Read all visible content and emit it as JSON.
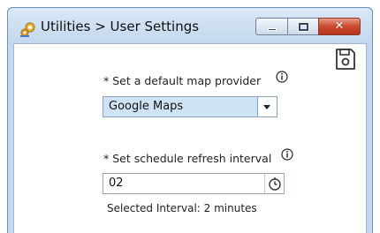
{
  "window": {
    "title": "Utilities > User Settings",
    "minimize_label": "minimize",
    "maximize_label": "maximize",
    "close_glyph": "✕"
  },
  "icons": {
    "app": "settings-gear-icon",
    "save": "save-icon",
    "info": "info-icon",
    "clock": "clock-icon",
    "dropdown": "chevron-down-icon"
  },
  "form": {
    "map_provider": {
      "label": "* Set a default map provider",
      "selected": "Google Maps"
    },
    "refresh_interval": {
      "label": "* Set schedule refresh interval",
      "value": "02",
      "helper": "Selected Interval: 2 minutes"
    }
  },
  "colors": {
    "frame": "#c3d8ee",
    "select_bg": "#cfe3f6",
    "close_button": "#c94a2f"
  }
}
